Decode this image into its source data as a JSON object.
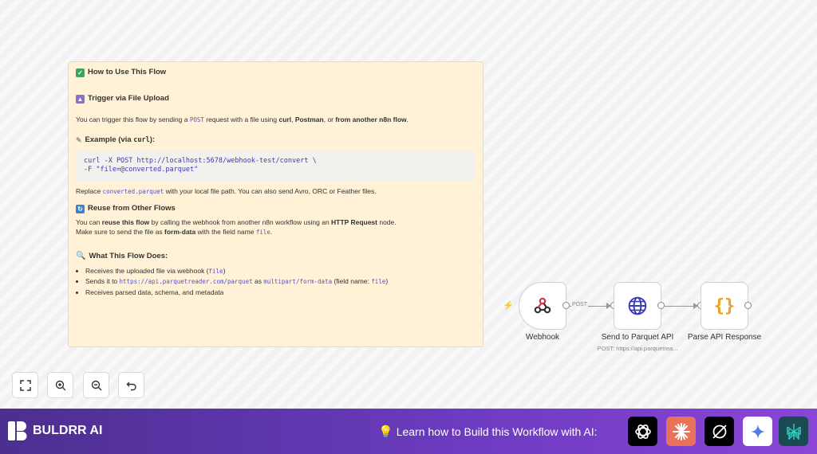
{
  "note": {
    "title": "How to Use This Flow",
    "trigger_heading": "Trigger via File Upload",
    "trigger_text_1": "You can trigger this flow by sending a ",
    "trigger_code": "POST",
    "trigger_text_2": " request with a file using ",
    "trigger_curl": "curl",
    "trigger_comma": ", ",
    "trigger_postman": "Postman",
    "trigger_or": ", or ",
    "trigger_n8n": "from another n8n flow",
    "trigger_end": ".",
    "example_heading": "Example (via ",
    "example_code": "curl",
    "example_end": "):",
    "code_line_1": "curl -X POST http://localhost:5678/webhook-test/convert \\",
    "code_line_2": "-F \"file=@converted.parquet\"",
    "replace_1": "Replace ",
    "replace_code": "converted.parquet",
    "replace_2": " with your local file path. You can also send Avro, ORC or Feather files.",
    "reuse_heading": "Reuse from Other Flows",
    "reuse_1": "You can ",
    "reuse_bold": "reuse this flow",
    "reuse_2": " by calling the webhook from another n8n workflow using an ",
    "reuse_http": "HTTP Request",
    "reuse_3": " node.",
    "reuse_4": "Make sure to send the file as ",
    "reuse_form": "form-data",
    "reuse_5": " with the field name ",
    "reuse_code": "file",
    "reuse_6": ".",
    "does_heading": "What This Flow Does:",
    "b1_1": "Receives the uploaded file via webhook (",
    "b1_code": "file",
    "b1_2": ")",
    "b2_1": "Sends it to ",
    "b2_code1": "https://api.parquetreader.com/parquet",
    "b2_2": " as ",
    "b2_code2": "multipart/form-data",
    "b2_3": " (field name: ",
    "b2_code3": "file",
    "b2_4": ")",
    "b3": "Receives parsed data, schema, and metadata"
  },
  "nodes": {
    "webhook_label": "Webhook",
    "parquet_label": "Send to Parquet API",
    "parquet_sub": "POST: https://api.parquetrea...",
    "parse_label": "Parse API Response",
    "conn_label": "POST"
  },
  "footer": {
    "brand": "BULDRR AI",
    "learn": "Learn how to Build this Workflow with AI:"
  },
  "colors": {
    "footer_start": "#4b2f8f",
    "footer_end": "#8a45d6",
    "note_bg": "#fff2d6",
    "webhook_icon": "#d6364a",
    "globe_icon": "#3b3ab8",
    "braces_icon": "#f0a020"
  }
}
